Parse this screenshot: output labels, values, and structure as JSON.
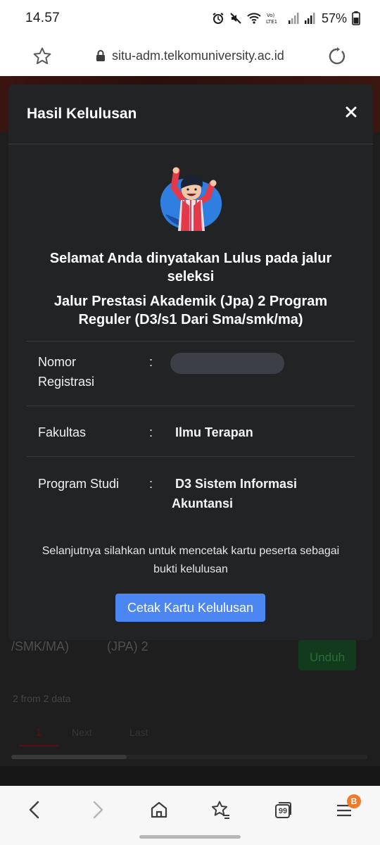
{
  "status_bar": {
    "time": "14.57",
    "battery": "57%",
    "network_label": "Vo) LTE1"
  },
  "browser": {
    "url": "situ-adm.telkomuniversity.ac.id"
  },
  "background_page": {
    "row_text_a": "/SMK/MA)",
    "row_text_b": "(JPA)  2",
    "download_button": "Unduh",
    "count_text": "2 from 2 data",
    "pages": [
      "1",
      "Next",
      "Last"
    ]
  },
  "modal": {
    "title": "Hasil Kelulusan",
    "headline": "Selamat Anda dinyatakan Lulus pada jalur seleksi",
    "track": "Jalur Prestasi Akademik (Jpa) 2 Program Reguler (D3/s1 Dari Sma/smk/ma)",
    "fields": [
      {
        "label": "Nomor Registrasi",
        "colon": ":",
        "value": ""
      },
      {
        "label": "Fakultas",
        "colon": ":",
        "value": "Ilmu Terapan"
      },
      {
        "label": "Program Studi",
        "colon": ":",
        "value": "D3 Sistem Informasi Akuntansi"
      }
    ],
    "footnote": "Selanjutnya silahkan untuk mencetak kartu peserta sebagai bukti kelulusan",
    "print_button": "Cetak Kartu Kelulusan"
  },
  "bottom_nav": {
    "tabs_count": "99",
    "menu_badge": "B"
  },
  "colors": {
    "modal_bg": "#222325",
    "primary_button": "#4c86f2",
    "download_button": "#123a1c",
    "badge": "#f07a2a"
  },
  "icons": [
    "star-icon",
    "lock-icon",
    "reload-icon",
    "close-icon",
    "back-icon",
    "forward-icon",
    "home-icon",
    "bookmarks-icon",
    "tabs-icon",
    "menu-icon"
  ]
}
